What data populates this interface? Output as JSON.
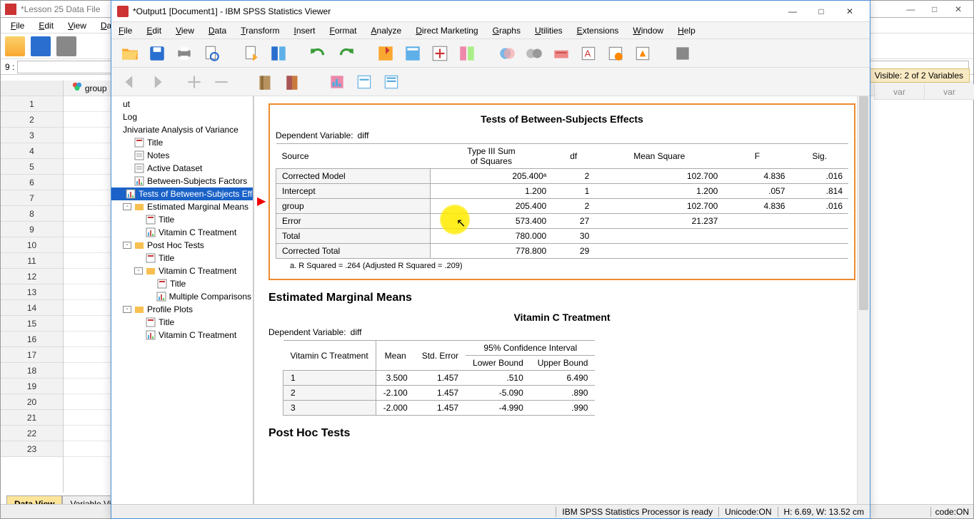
{
  "bg": {
    "title": "*Lesson 25 Data File",
    "menus": [
      "File",
      "Edit",
      "View",
      "Data"
    ],
    "cellref": "9 :",
    "visible": "Visible: 2 of 2 Variables",
    "col_group": "group",
    "cols": [
      "var",
      "var"
    ],
    "rows": [
      1,
      2,
      3,
      4,
      5,
      6,
      7,
      8,
      9,
      10,
      11,
      12,
      13,
      14,
      15,
      16,
      17,
      18,
      19,
      20,
      21,
      22,
      23
    ],
    "tabs": {
      "active": "Data View",
      "other": "Variable View"
    },
    "status_code": "code:ON"
  },
  "viewer": {
    "title": "*Output1 [Document1] - IBM SPSS Statistics Viewer",
    "menus": [
      "File",
      "Edit",
      "View",
      "Data",
      "Transform",
      "Insert",
      "Format",
      "Analyze",
      "Direct Marketing",
      "Graphs",
      "Utilities",
      "Extensions",
      "Window",
      "Help"
    ],
    "outline": {
      "items": [
        {
          "label": "ut",
          "indent": 0,
          "icon": ""
        },
        {
          "label": "Log",
          "indent": 0,
          "icon": ""
        },
        {
          "label": "Jnivariate Analysis of Variance",
          "indent": 0,
          "icon": ""
        },
        {
          "label": "Title",
          "indent": 1,
          "icon": "title"
        },
        {
          "label": "Notes",
          "indent": 1,
          "icon": "notes"
        },
        {
          "label": "Active Dataset",
          "indent": 1,
          "icon": "notes"
        },
        {
          "label": "Between-Subjects Factors",
          "indent": 1,
          "icon": "chart"
        },
        {
          "label": "Tests of Between-Subjects Effec",
          "indent": 1,
          "icon": "chart",
          "selected": true
        },
        {
          "label": "Estimated Marginal Means",
          "indent": 1,
          "icon": "folder",
          "toggle": "-"
        },
        {
          "label": "Title",
          "indent": 2,
          "icon": "title"
        },
        {
          "label": "Vitamin C Treatment",
          "indent": 2,
          "icon": "chart"
        },
        {
          "label": "Post Hoc Tests",
          "indent": 1,
          "icon": "folder",
          "toggle": "-"
        },
        {
          "label": "Title",
          "indent": 2,
          "icon": "title"
        },
        {
          "label": "Vitamin C Treatment",
          "indent": 2,
          "icon": "folder",
          "toggle": "-"
        },
        {
          "label": "Title",
          "indent": 3,
          "icon": "title"
        },
        {
          "label": "Multiple Comparisons",
          "indent": 3,
          "icon": "chart"
        },
        {
          "label": "Profile Plots",
          "indent": 1,
          "icon": "folder",
          "toggle": "-"
        },
        {
          "label": "Title",
          "indent": 2,
          "icon": "title"
        },
        {
          "label": "Vitamin C Treatment",
          "indent": 2,
          "icon": "chart"
        }
      ]
    },
    "anova": {
      "title": "Tests of Between-Subjects Effects",
      "depvar_label": "Dependent Variable:",
      "depvar": "diff",
      "headers": [
        "Source",
        "Type III Sum of Squares",
        "df",
        "Mean Square",
        "F",
        "Sig."
      ],
      "rows": [
        {
          "src": "Corrected Model",
          "ss": "205.400ᵃ",
          "df": "2",
          "ms": "102.700",
          "f": "4.836",
          "sig": ".016"
        },
        {
          "src": "Intercept",
          "ss": "1.200",
          "df": "1",
          "ms": "1.200",
          "f": ".057",
          "sig": ".814"
        },
        {
          "src": "group",
          "ss": "205.400",
          "df": "2",
          "ms": "102.700",
          "f": "4.836",
          "sig": ".016"
        },
        {
          "src": "Error",
          "ss": "573.400",
          "df": "27",
          "ms": "21.237",
          "f": "",
          "sig": ""
        },
        {
          "src": "Total",
          "ss": "780.000",
          "df": "30",
          "ms": "",
          "f": "",
          "sig": ""
        },
        {
          "src": "Corrected Total",
          "ss": "778.800",
          "df": "29",
          "ms": "",
          "f": "",
          "sig": ""
        }
      ],
      "footnote": "a. R Squared = .264 (Adjusted R Squared = .209)"
    },
    "emm": {
      "heading": "Estimated Marginal Means",
      "subtitle": "Vitamin C Treatment",
      "depvar_label": "Dependent Variable:",
      "depvar": "diff",
      "ci_header": "95% Confidence Interval",
      "headers": [
        "Vitamin C Treatment",
        "Mean",
        "Std. Error",
        "Lower Bound",
        "Upper Bound"
      ],
      "rows": [
        {
          "g": "1",
          "mean": "3.500",
          "se": "1.457",
          "lb": ".510",
          "ub": "6.490"
        },
        {
          "g": "2",
          "mean": "-2.100",
          "se": "1.457",
          "lb": "-5.090",
          "ub": ".890"
        },
        {
          "g": "3",
          "mean": "-2.000",
          "se": "1.457",
          "lb": "-4.990",
          "ub": ".990"
        }
      ]
    },
    "posthoc_heading": "Post Hoc Tests",
    "status": {
      "proc": "IBM SPSS Statistics Processor is ready",
      "unicode": "Unicode:ON",
      "hw": "H: 6.69, W: 13.52 cm"
    }
  },
  "chart_data": [
    {
      "type": "table",
      "title": "Tests of Between-Subjects Effects (ANOVA, Dependent Variable: diff)",
      "columns": [
        "Source",
        "Type III Sum of Squares",
        "df",
        "Mean Square",
        "F",
        "Sig."
      ],
      "rows": [
        [
          "Corrected Model",
          205.4,
          2,
          102.7,
          4.836,
          0.016
        ],
        [
          "Intercept",
          1.2,
          1,
          1.2,
          0.057,
          0.814
        ],
        [
          "group",
          205.4,
          2,
          102.7,
          4.836,
          0.016
        ],
        [
          "Error",
          573.4,
          27,
          21.237,
          null,
          null
        ],
        [
          "Total",
          780.0,
          30,
          null,
          null,
          null
        ],
        [
          "Corrected Total",
          778.8,
          29,
          null,
          null,
          null
        ]
      ],
      "note": "R Squared = .264 (Adjusted R Squared = .209)"
    },
    {
      "type": "table",
      "title": "Estimated Marginal Means — Vitamin C Treatment (Dependent Variable: diff, 95% CI)",
      "columns": [
        "Vitamin C Treatment",
        "Mean",
        "Std. Error",
        "Lower Bound",
        "Upper Bound"
      ],
      "rows": [
        [
          1,
          3.5,
          1.457,
          0.51,
          6.49
        ],
        [
          2,
          -2.1,
          1.457,
          -5.09,
          0.89
        ],
        [
          3,
          -2.0,
          1.457,
          -4.99,
          0.99
        ]
      ]
    }
  ]
}
